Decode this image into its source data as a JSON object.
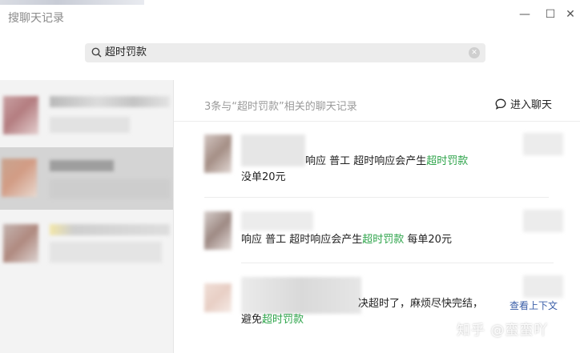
{
  "window": {
    "title": "搜聊天记录"
  },
  "search": {
    "value": "超时罚款"
  },
  "results": {
    "summary": "3条与“超时罚款”相关的聊天记录",
    "enter_chat": "进入聊天",
    "messages": [
      {
        "lines": [
          {
            "pre": "响应  普工  超时响应会产生",
            "hl": "超时罚款",
            "post": ""
          },
          {
            "pre": "没单20元",
            "hl": "",
            "post": ""
          }
        ]
      },
      {
        "lines": [
          {
            "pre": "响应  普工  超时响应会产生",
            "hl": "超时罚款",
            "post": " 每单20元"
          }
        ]
      },
      {
        "lines": [
          {
            "pre": "决超时了，麻烦尽快完结，",
            "hl": "",
            "post": ""
          },
          {
            "pre": "避免",
            "hl": "超时罚款",
            "post": ""
          }
        ],
        "context_link": "查看上下文"
      }
    ]
  },
  "watermark": "知乎 @蛮蛮吖",
  "colors": {
    "highlight": "#2ca349",
    "link": "#3a5ea8",
    "selected_row": "#d4d4d4"
  }
}
